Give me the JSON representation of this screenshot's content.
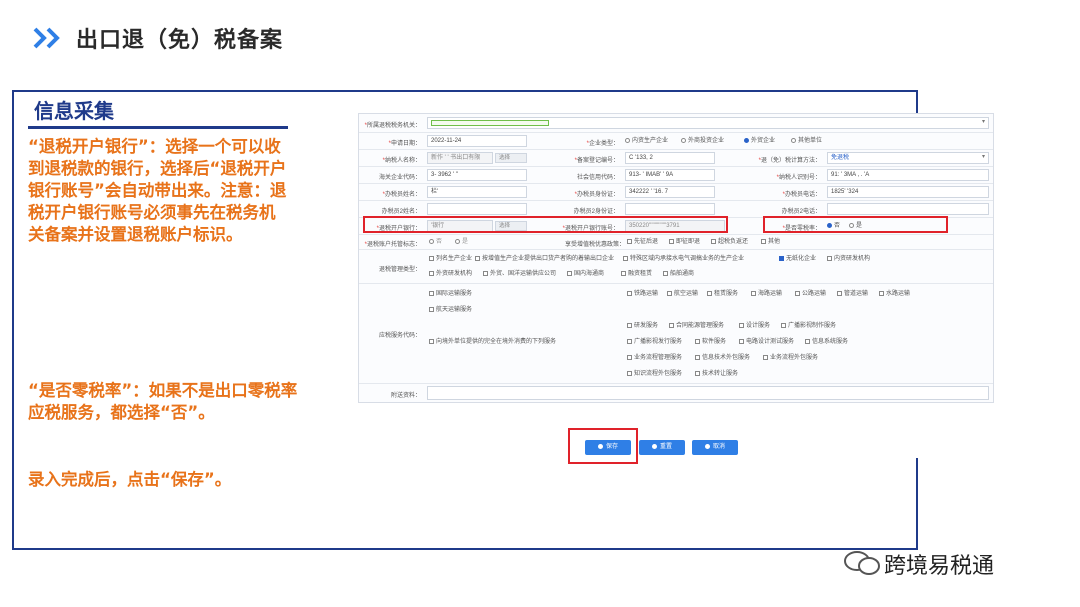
{
  "header": {
    "title": "出口退（免）税备案"
  },
  "panel": {
    "title": "信息采集"
  },
  "notes": {
    "note1": "“退税开户银行”：选择一个可以收到退税款的银行，选择后“退税开户银行账号”会自动带出来。注意：退税开户银行账号必须事先在税务机关备案并设置退税账户标识。",
    "note2": "“是否零税率”：如果不是出口零税率应税服务，都选择“否”。",
    "note3": "录入完成后，点击“保存”。"
  },
  "form": {
    "authority_label": "所属退税税务机关：",
    "date_label": "申请日期：",
    "date_value": "2022-11-24",
    "ent_type_label": "企业类型：",
    "ent_type_options": [
      "内资生产企业",
      "外商投资企业",
      "外贸企业",
      "其他单位"
    ],
    "taxpayer_name_label": "纳税人名称：",
    "taxpayer_name_value": "新作 '  ' 书出口有限",
    "select_btn": "选择",
    "reg_no_label": "备案登记编号：",
    "reg_no_value": "C  '133, 2",
    "method_label": "退（免）税计算方法：",
    "method_value": "免退税",
    "customs_label": "海关企业代码：",
    "customs_value": "3-  3962  ' \"",
    "credit_label": "社会信用代码：",
    "credit_value": "913-  ' IMAB'  '  9A",
    "taxid_label": "纳税人识别号：",
    "taxid_value": "91:  ' 3MA  ,  .  'A",
    "handler_label": "办税员姓名：",
    "handler_value": "栏'",
    "handler_id_label": "办税员身份证：",
    "handler_id_value": "342222  '  '16.  7",
    "handler_tel_label": "办税员电话：",
    "handler_tel_value": "1825'   '324",
    "handler2_label": "办税员2姓名：",
    "handler2_id_label": "办税员2身份证：",
    "handler2_tel_label": "办税员2电话：",
    "bank_label": "退税开户银行：",
    "bank_value": "'银行",
    "account_label": "退税开户银行账号：",
    "account_value": "350220'''''''''''''''3791",
    "zero_label": "是否零税率：",
    "zero_options": [
      "否",
      "是"
    ],
    "account_flag_label": "退税账户托管标志：",
    "account_flag_options": [
      "否",
      "是"
    ],
    "policy_label": "享受增值税优惠政策：",
    "policy_options": [
      "先征后退",
      "即征即退",
      "超税负返还",
      "其他"
    ],
    "mgmt_label": "退税管理类型：",
    "mgmt_options": [
      "列名生产企业",
      "按增值生产企业提供出口货产者购的着输出口企业",
      "特殊区域内承接水电气调搞业务的生产企业",
      "无纸化企业",
      "内资研发机构",
      "外资研发机构",
      "外贸、国洋运输供应公司",
      "国内海通商",
      "融资租赁",
      "船舶通商"
    ],
    "service_label": "应税服务代码：",
    "service_row1": [
      "国际运输服务",
      "铁路运输",
      "航空运输",
      "租赁服务",
      "海路运输",
      "公路运输",
      "管道运输",
      "水路运输"
    ],
    "service_row2": [
      "航天运输服务"
    ],
    "service_row3": [
      "研发服务",
      "合同能源管理服务",
      "设计服务",
      "广播影视制作服务"
    ],
    "service_row4": [
      "广播影视发行服务",
      "软件服务",
      "电路设计测试服务",
      "信息系统服务"
    ],
    "service_row5": [
      "业务流程管理服务",
      "信息技术外包服务",
      "业务流程外包服务"
    ],
    "service_row6": [
      "知识流程外包服务",
      "技术转让服务"
    ],
    "service_offshore": "向境外单位提供的完全在境外消费的下列服务",
    "attach_label": "附送资料："
  },
  "actions": {
    "save": "保存",
    "reset": "重置",
    "cancel": "取消"
  },
  "watermark": "跨境易税通",
  "colors": {
    "accent": "#e8731a",
    "brand": "#1f3a8a",
    "highlight": "#e0222a",
    "button": "#2f7fe6"
  }
}
